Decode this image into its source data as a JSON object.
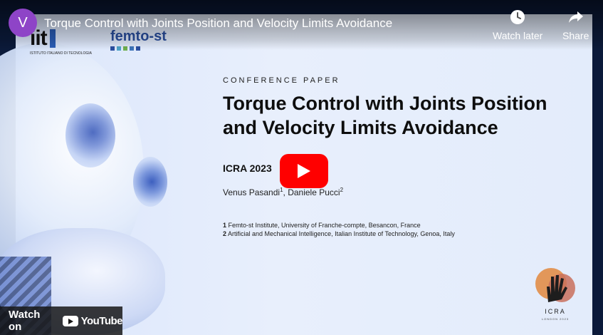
{
  "channel": {
    "avatar_letter": "V",
    "avatar_color": "#8e44c7"
  },
  "video": {
    "title": "Torque Control with Joints Position and Velocity Limits Avoidance"
  },
  "actions": {
    "watch_later": "Watch later",
    "share": "Share"
  },
  "slide": {
    "logos": {
      "iit_mark": "iit",
      "iit_sub": "ISTITUTO ITALIANO DI TECNOLOGIA",
      "femto": "femto-st"
    },
    "label": "CONFERENCE PAPER",
    "title": "Torque Control with Joints Position and Velocity Limits Avoidance",
    "venue": "ICRA 2023",
    "author1": "Venus Pasandi",
    "author1_sup": "1",
    "author2": "Daniele Pucci",
    "author2_sup": "2",
    "affil1_num": "1",
    "affil1": "Femto-st Institute, University of Franche-compte, Besancon, France",
    "affil2_num": "2",
    "affil2": "Artificial and Mechanical Intelligence, Italian Institute of Technology, Genoa, Italy",
    "icra_logo": {
      "name": "ICRA",
      "place": "LONDON 2023"
    }
  },
  "footer": {
    "watch_on": "Watch on",
    "youtube": "YouTube"
  },
  "colors": {
    "play_red": "#ff0000",
    "slide_bg": "#e3ecfb"
  }
}
